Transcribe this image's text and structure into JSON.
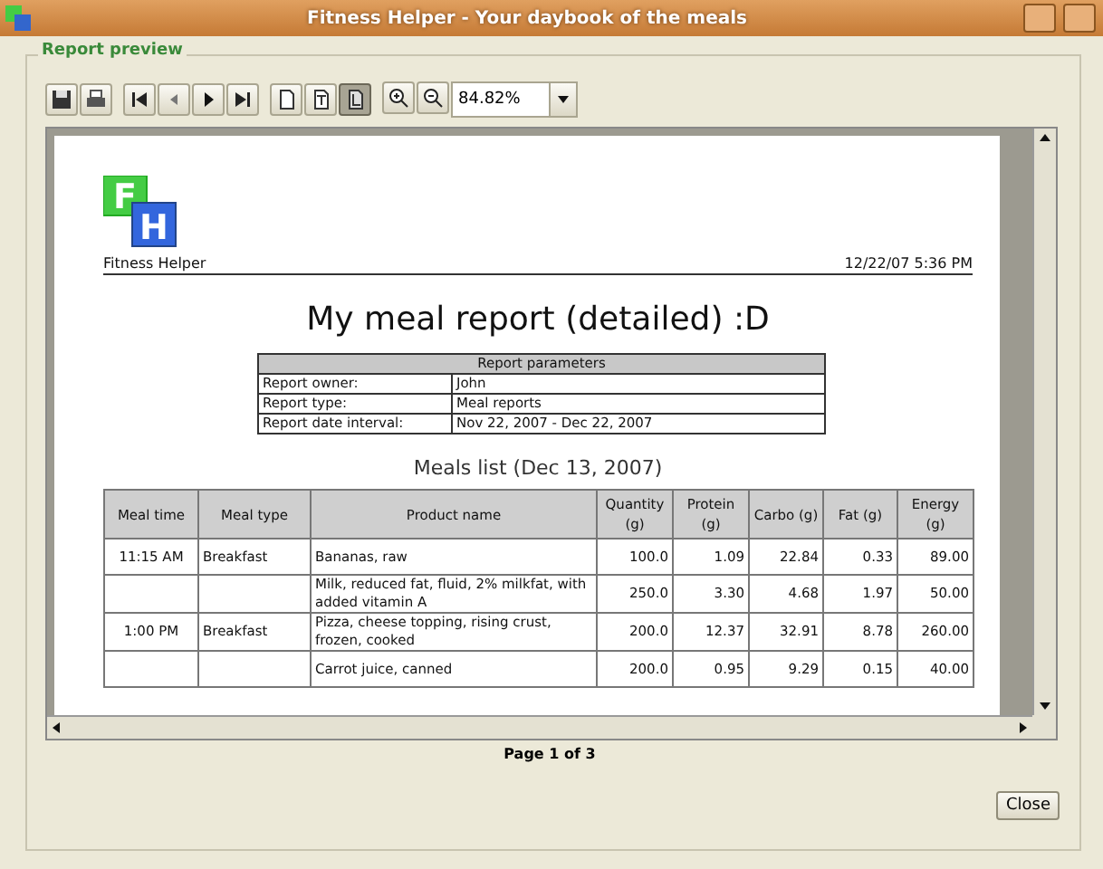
{
  "window": {
    "title": "Fitness Helper - Your daybook of the meals"
  },
  "group_title": "Report preview",
  "toolbar": {
    "view_modes": [
      {
        "kind": "single",
        "selected": false
      },
      {
        "kind": "width",
        "selected": false
      },
      {
        "kind": "page",
        "selected": true
      }
    ],
    "zoom": "84.82%"
  },
  "report": {
    "brand": "Fitness Helper",
    "logo_letters": [
      "F",
      "H"
    ],
    "timestamp": "12/22/07 5:36 PM",
    "title": "My meal report (detailed) :D",
    "parameters": {
      "heading": "Report parameters",
      "rows": [
        [
          "Report owner:",
          "John"
        ],
        [
          "Report type:",
          "Meal reports"
        ],
        [
          "Report date interval:",
          "Nov 22, 2007 - Dec 22, 2007"
        ]
      ]
    },
    "meals_title": "Meals list (Dec 13, 2007)",
    "columns": [
      "Meal time",
      "Meal type",
      "Product name",
      "Quantity (g)",
      "Protein (g)",
      "Carbo (g)",
      "Fat (g)",
      "Energy (g)"
    ],
    "rows": [
      [
        "11:15 AM",
        "Breakfast",
        "Bananas, raw",
        "100.0",
        "1.09",
        "22.84",
        "0.33",
        "89.00"
      ],
      [
        "",
        "",
        "Milk, reduced fat, fluid, 2% milkfat, with added vitamin A",
        "250.0",
        "3.30",
        "4.68",
        "1.97",
        "50.00"
      ],
      [
        "1:00 PM",
        "Breakfast",
        "Pizza, cheese topping, rising crust, frozen, cooked",
        "200.0",
        "12.37",
        "32.91",
        "8.78",
        "260.00"
      ],
      [
        "",
        "",
        "Carrot juice, canned",
        "200.0",
        "0.95",
        "9.29",
        "0.15",
        "40.00"
      ]
    ]
  },
  "page_indicator": "Page 1 of 3",
  "buttons": [
    "Close"
  ]
}
